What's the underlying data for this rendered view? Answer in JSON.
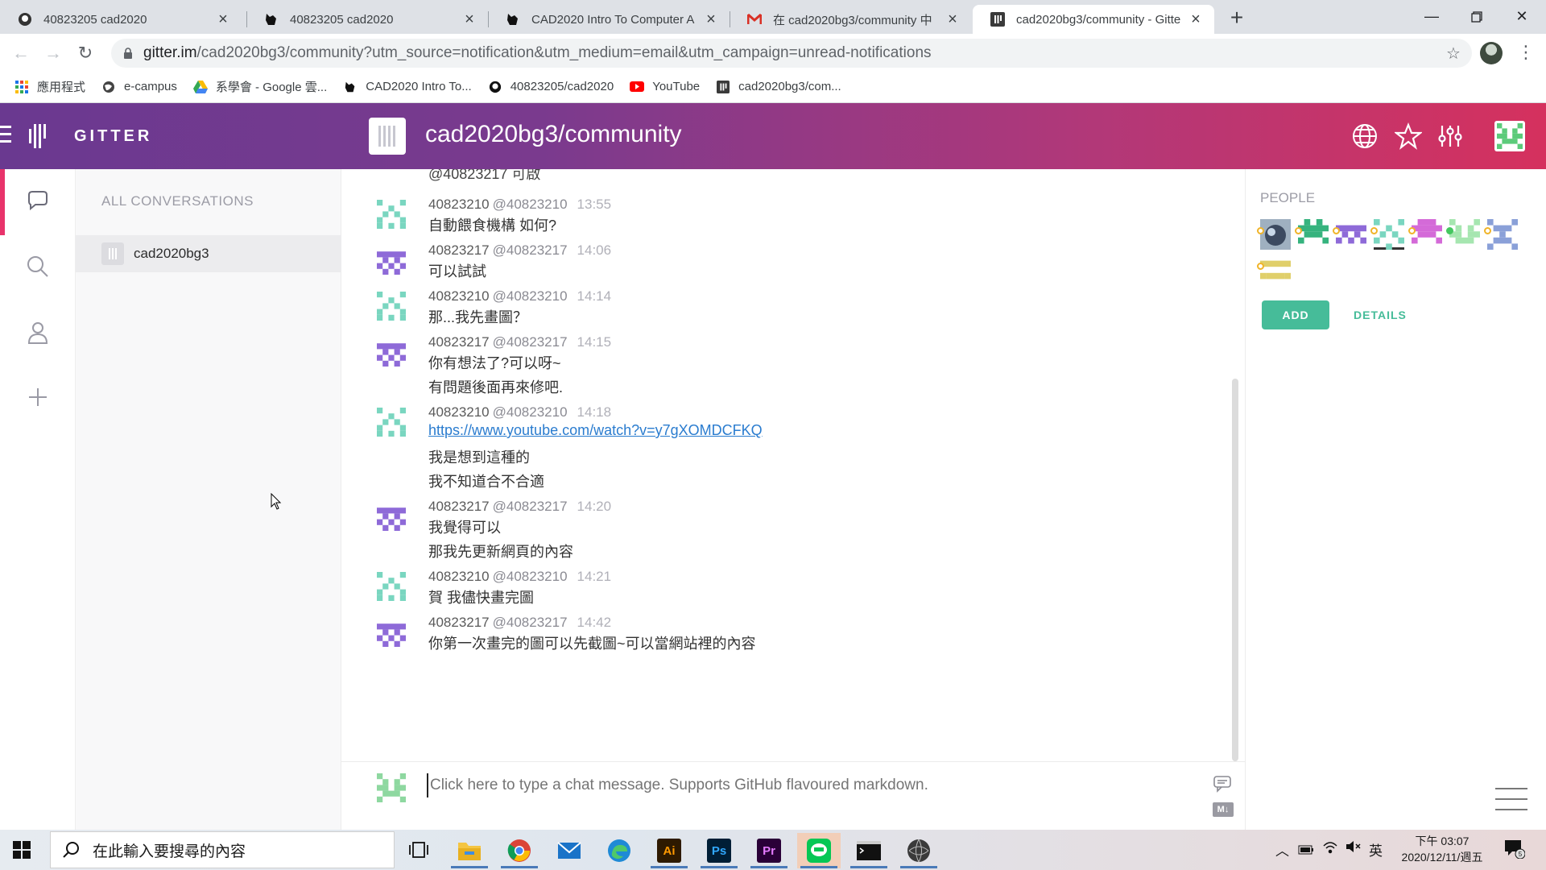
{
  "browser": {
    "tabs": [
      {
        "title": "40823205 cad2020",
        "icon": "github-icon"
      },
      {
        "title": "40823205 cad2020",
        "icon": "cat-icon"
      },
      {
        "title": "CAD2020 Intro To Computer A",
        "icon": "cat-icon"
      },
      {
        "title": "在 cad2020bg3/community 中",
        "icon": "gmail-icon"
      },
      {
        "title": "cad2020bg3/community - Gitte",
        "icon": "gitter-icon"
      }
    ],
    "url_main": "gitter.im",
    "url_rest": "/cad2020bg3/community?utm_source=notification&utm_medium=email&utm_campaign=unread-notifications",
    "bookmarks": [
      {
        "label": "應用程式",
        "icon": "apps-grid-icon"
      },
      {
        "label": "e-campus",
        "icon": "globe-icon"
      },
      {
        "label": "系學會 - Google 雲...",
        "icon": "google-drive-icon"
      },
      {
        "label": "CAD2020 Intro To...",
        "icon": "cat-icon"
      },
      {
        "label": "40823205/cad2020",
        "icon": "github-icon"
      },
      {
        "label": "YouTube",
        "icon": "youtube-icon"
      },
      {
        "label": "cad2020bg3/com...",
        "icon": "gitter-icon"
      }
    ]
  },
  "gitter": {
    "brand": "GITTER",
    "room_name": "cad2020bg3/community",
    "sidebar": {
      "heading": "ALL CONVERSATIONS",
      "rooms": [
        {
          "name": "cad2020bg3"
        }
      ]
    },
    "chat": {
      "partial_text": "@40823217 可啟",
      "messages": [
        {
          "name": "40823210",
          "handle": "@40823210",
          "time": "13:55",
          "avatar": "teal",
          "lines": [
            "自動餵食機構 如何?"
          ]
        },
        {
          "name": "40823217",
          "handle": "@40823217",
          "time": "14:06",
          "avatar": "purple",
          "lines": [
            "可以試試"
          ]
        },
        {
          "name": "40823210",
          "handle": "@40823210",
          "time": "14:14",
          "avatar": "teal",
          "lines": [
            "那...我先畫圖？"
          ]
        },
        {
          "name": "40823217",
          "handle": "@40823217",
          "time": "14:15",
          "avatar": "purple",
          "lines": [
            "你有想法了?可以呀~",
            "有問題後面再來修吧."
          ]
        },
        {
          "name": "40823210",
          "handle": "@40823210",
          "time": "14:18",
          "avatar": "teal",
          "lines": [
            "https://www.youtube.com/watch?v=y7gXOMDCFKQ",
            "我是想到這種的",
            "我不知道合不合適"
          ]
        },
        {
          "name": "40823217",
          "handle": "@40823217",
          "time": "14:20",
          "avatar": "purple",
          "lines": [
            "我覺得可以",
            "那我先更新網頁的內容"
          ]
        },
        {
          "name": "40823210",
          "handle": "@40823210",
          "time": "14:21",
          "avatar": "teal",
          "lines": [
            "賀 我儘快畫完圖"
          ]
        },
        {
          "name": "40823217",
          "handle": "@40823217",
          "time": "14:42",
          "avatar": "purple",
          "lines": [
            "你第一次畫完的圖可以先截圖~可以當網站裡的內容"
          ]
        }
      ],
      "composer_placeholder": "Click here to type a chat message. Supports GitHub flavoured markdown.",
      "markdown_badge": "M↓"
    },
    "people": {
      "title": "PEOPLE",
      "add_label": "ADD",
      "details_label": "DETAILS"
    },
    "colors": {
      "header_start": "#6a3990",
      "header_end": "#d5315e",
      "accent": "#46bc99",
      "active_bar": "#e8336b",
      "link": "#2a7ccf"
    }
  },
  "taskbar": {
    "search_placeholder": "在此輸入要搜尋的內容",
    "apps": [
      "Ai",
      "Ps",
      "Pr"
    ],
    "ime": "英",
    "time": "下午 03:07",
    "date": "2020/12/11/週五",
    "notification_count": "5"
  }
}
